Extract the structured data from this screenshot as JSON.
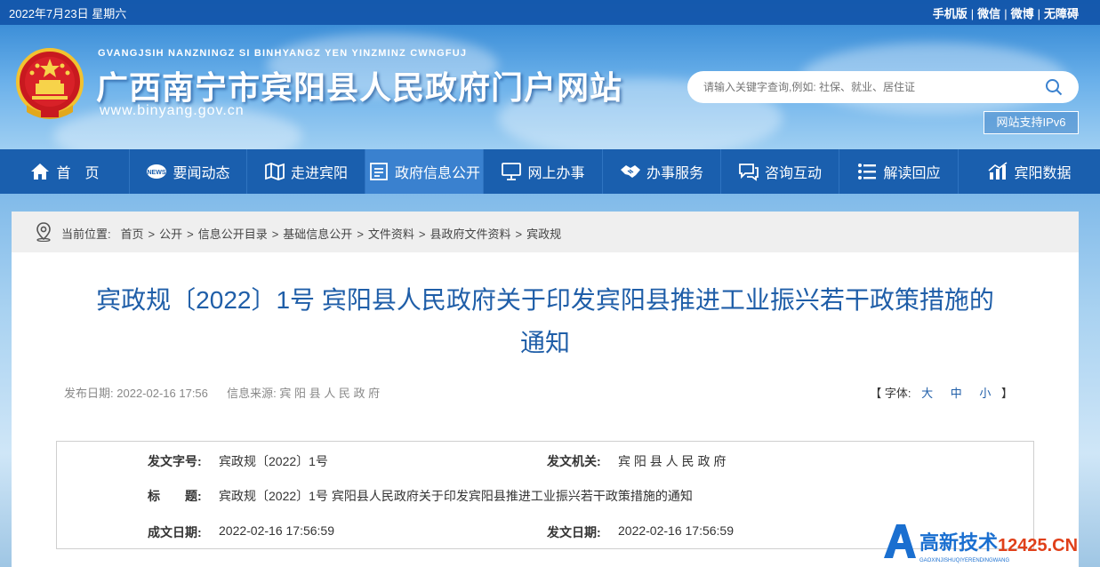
{
  "topbar": {
    "date": "2022年7月23日  星期六",
    "links": [
      "手机版",
      "微信",
      "微博",
      "无障碍"
    ]
  },
  "header": {
    "pinyin": "GVANGJSIH NANZNINGZ SI BINHYANGZ YEN YINZMINZ CWNGFUJ",
    "title": "广西南宁市宾阳县人民政府门户网站",
    "url": "www.binyang.gov.cn",
    "search_placeholder": "请输入关键字查询,例如: 社保、就业、居住证",
    "ipv6": "网站支持IPv6"
  },
  "nav": [
    {
      "label": "首　页",
      "icon": "home-icon"
    },
    {
      "label": "要闻动态",
      "icon": "news-icon"
    },
    {
      "label": "走进宾阳",
      "icon": "map-icon"
    },
    {
      "label": "政府信息公开",
      "icon": "document-icon"
    },
    {
      "label": "网上办事",
      "icon": "monitor-icon"
    },
    {
      "label": "办事服务",
      "icon": "handshake-icon"
    },
    {
      "label": "咨询互动",
      "icon": "chat-icon"
    },
    {
      "label": "解读回应",
      "icon": "list-icon"
    },
    {
      "label": "宾阳数据",
      "icon": "bar-chart-icon"
    }
  ],
  "breadcrumb": {
    "prefix": "当前位置:",
    "items": [
      "首页",
      "公开",
      "信息公开目录",
      "基础信息公开",
      "文件资料",
      "县政府文件资料",
      "宾政规"
    ]
  },
  "article": {
    "title_line1": "宾政规〔2022〕1号 宾阳县人民政府关于印发宾阳县推进工业振兴若干政策措施的",
    "title_line2": "通知",
    "publish_label": "发布日期:",
    "publish_date": "2022-02-16 17:56",
    "source_label": "信息来源:",
    "source": "宾 阳 县 人 民 政 府",
    "fontsize_label": "【 字体:",
    "fontsize_large": "大",
    "fontsize_medium": "中",
    "fontsize_small": "小",
    "fontsize_end": "】"
  },
  "info": {
    "docno_label": "发文字号:",
    "docno": "宾政规〔2022〕1号",
    "issuer_label": "发文机关:",
    "issuer": "宾 阳 县 人 民 政 府",
    "subject_label": "标　　题:",
    "subject": "宾政规〔2022〕1号 宾阳县人民政府关于印发宾阳县推进工业振兴若干政策措施的通知",
    "created_label": "成文日期:",
    "created": "2022-02-16 17:56:59",
    "issued_label": "发文日期:",
    "issued": "2022-02-16 17:56:59"
  },
  "watermark": {
    "brand": "高新技术",
    "domain": "12425.CN",
    "sub": "GAOXINJISHUQIYERENDINGWANG"
  },
  "colors": {
    "nav_bg": "#1a5fae",
    "nav_active": "#3a81cf",
    "title_blue": "#1f5ea8"
  }
}
